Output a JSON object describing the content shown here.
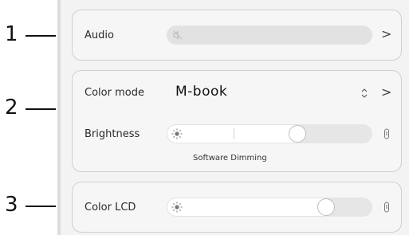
{
  "callouts": [
    "1",
    "2",
    "3"
  ],
  "audio": {
    "label": "Audio",
    "icon": "speaker-muted-icon",
    "chevron": ">"
  },
  "color_mode": {
    "label": "Color mode",
    "value": "M-book",
    "sort_icon": "up-down-chevron-icon",
    "chevron": ">"
  },
  "brightness": {
    "label": "Brightness",
    "icon": "sun-icon",
    "level": 0.65,
    "note": "Software Dimming",
    "end_icon": "lamp-icon"
  },
  "color_lcd": {
    "label": "Color LCD",
    "icon": "sun-icon",
    "level": 0.8,
    "end_icon": "lamp-icon"
  },
  "colors": {
    "panel": "#f3f3f3",
    "card": "#f6f6f6",
    "track": "#e6e6e6",
    "thumb": "#ffffff"
  }
}
